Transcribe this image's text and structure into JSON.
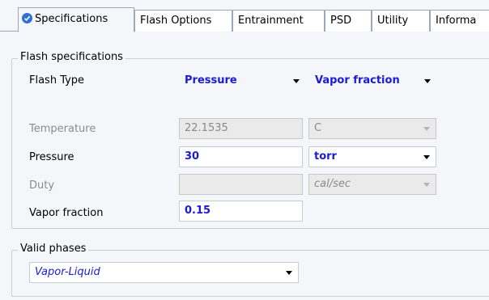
{
  "tabs": [
    {
      "label": "Specifications",
      "active": true,
      "icon": "check-circle-icon"
    },
    {
      "label": "Flash Options"
    },
    {
      "label": "Entrainment"
    },
    {
      "label": "PSD"
    },
    {
      "label": "Utility"
    },
    {
      "label": "Informa"
    }
  ],
  "flash_specs": {
    "title": "Flash specifications",
    "flash_type_label": "Flash Type",
    "flash_type_value1": "Pressure",
    "flash_type_value2": "Vapor fraction",
    "temperature_label": "Temperature",
    "temperature_value": "22.1535",
    "temperature_unit": "C",
    "pressure_label": "Pressure",
    "pressure_value": "30",
    "pressure_unit": "torr",
    "duty_label": "Duty",
    "duty_value": "",
    "duty_unit": "cal/sec",
    "vapor_fraction_label": "Vapor fraction",
    "vapor_fraction_value": "0.15"
  },
  "valid_phases": {
    "title": "Valid phases",
    "value": "Vapor-Liquid"
  },
  "colors": {
    "accent_blue": "#1b1bd6",
    "disabled_gray": "#8c8c8c",
    "check_icon": "#2f6fd6"
  }
}
